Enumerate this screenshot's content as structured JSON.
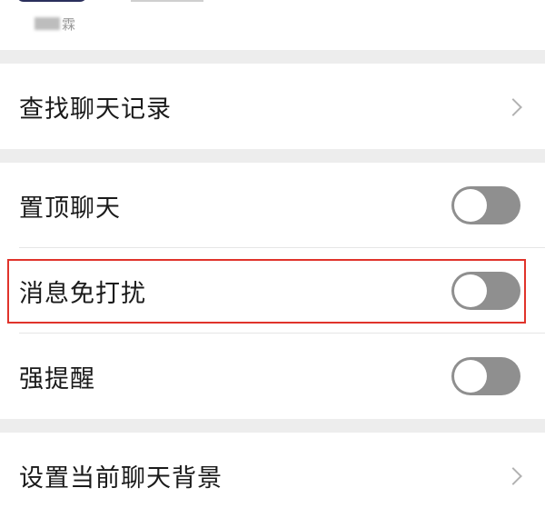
{
  "header": {
    "member_name_suffix": "霖"
  },
  "search_group": {
    "search_history_label": "查找聊天记录"
  },
  "toggles_group": {
    "items": [
      {
        "label": "置顶聊天",
        "on": false
      },
      {
        "label": "消息免打扰",
        "on": false
      },
      {
        "label": "强提醒",
        "on": false
      }
    ]
  },
  "background_group": {
    "set_background_label": "设置当前聊天背景"
  },
  "colors": {
    "page_background": "#ededed",
    "row_background": "#ffffff",
    "toggle_off": "#8f8f8f",
    "highlight": "#e0332b"
  }
}
